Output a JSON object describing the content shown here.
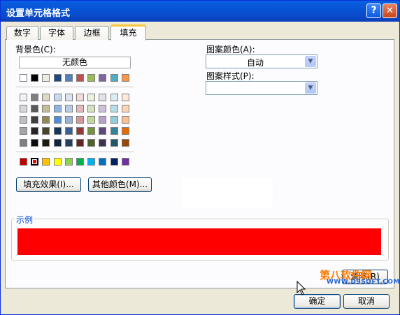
{
  "window": {
    "title": "设置单元格格式",
    "help_glyph": "?",
    "close_glyph": "✕"
  },
  "tabs": [
    {
      "label": "数字",
      "active": false
    },
    {
      "label": "字体",
      "active": false
    },
    {
      "label": "边框",
      "active": false
    },
    {
      "label": "填充",
      "active": true
    }
  ],
  "background": {
    "label": "背景色(C):",
    "no_color_button": "无颜色",
    "theme_top_row": [
      "#ffffff",
      "#000000",
      "#eeece1",
      "#1f497d",
      "#4f81bd",
      "#c0504d",
      "#9bbb59",
      "#8064a2",
      "#4bacc6",
      "#f79646"
    ],
    "theme_shades": [
      [
        "#f2f2f2",
        "#7f7f7f",
        "#ddd9c3",
        "#c6d9f0",
        "#dbe5f1",
        "#f2dcdb",
        "#ebf1dd",
        "#e5e0ec",
        "#dbeef3",
        "#fdeada"
      ],
      [
        "#d8d8d8",
        "#595959",
        "#c4bd97",
        "#8db3e2",
        "#b8cce4",
        "#e5b9b7",
        "#d7e3bc",
        "#ccc1d9",
        "#b7dde8",
        "#fbd5b5"
      ],
      [
        "#bfbfbf",
        "#3f3f3f",
        "#938953",
        "#548dd4",
        "#95b3d7",
        "#d99694",
        "#c3d69b",
        "#b2a2c7",
        "#92cddc",
        "#fac08f"
      ],
      [
        "#a5a5a5",
        "#262626",
        "#494429",
        "#17365d",
        "#366092",
        "#953734",
        "#76923c",
        "#5f497a",
        "#31859b",
        "#e36c09"
      ],
      [
        "#7f7f7f",
        "#0c0c0c",
        "#1d1b10",
        "#0f243e",
        "#244061",
        "#632423",
        "#4f6128",
        "#3f3151",
        "#205867",
        "#974806"
      ]
    ],
    "standard_colors": [
      "#c00000",
      "#ff0000",
      "#ffc000",
      "#ffff00",
      "#92d050",
      "#00b050",
      "#00b0f0",
      "#0070c0",
      "#002060",
      "#7030a0"
    ],
    "selected_standard_index": 1
  },
  "buttons": {
    "fill_effects": "填充效果(I)...",
    "more_colors": "其他颜色(M)...",
    "clear": "清除(R)",
    "ok": "确定",
    "cancel": "取消"
  },
  "pattern": {
    "color_label": "图案颜色(A):",
    "color_value": "自动",
    "style_label": "图案样式(P):",
    "style_value": ""
  },
  "sample": {
    "label": "示例",
    "color": "#ff0000"
  },
  "watermark": {
    "text": "第八软件网",
    "url": "WWW.D9SOFT.COM"
  }
}
